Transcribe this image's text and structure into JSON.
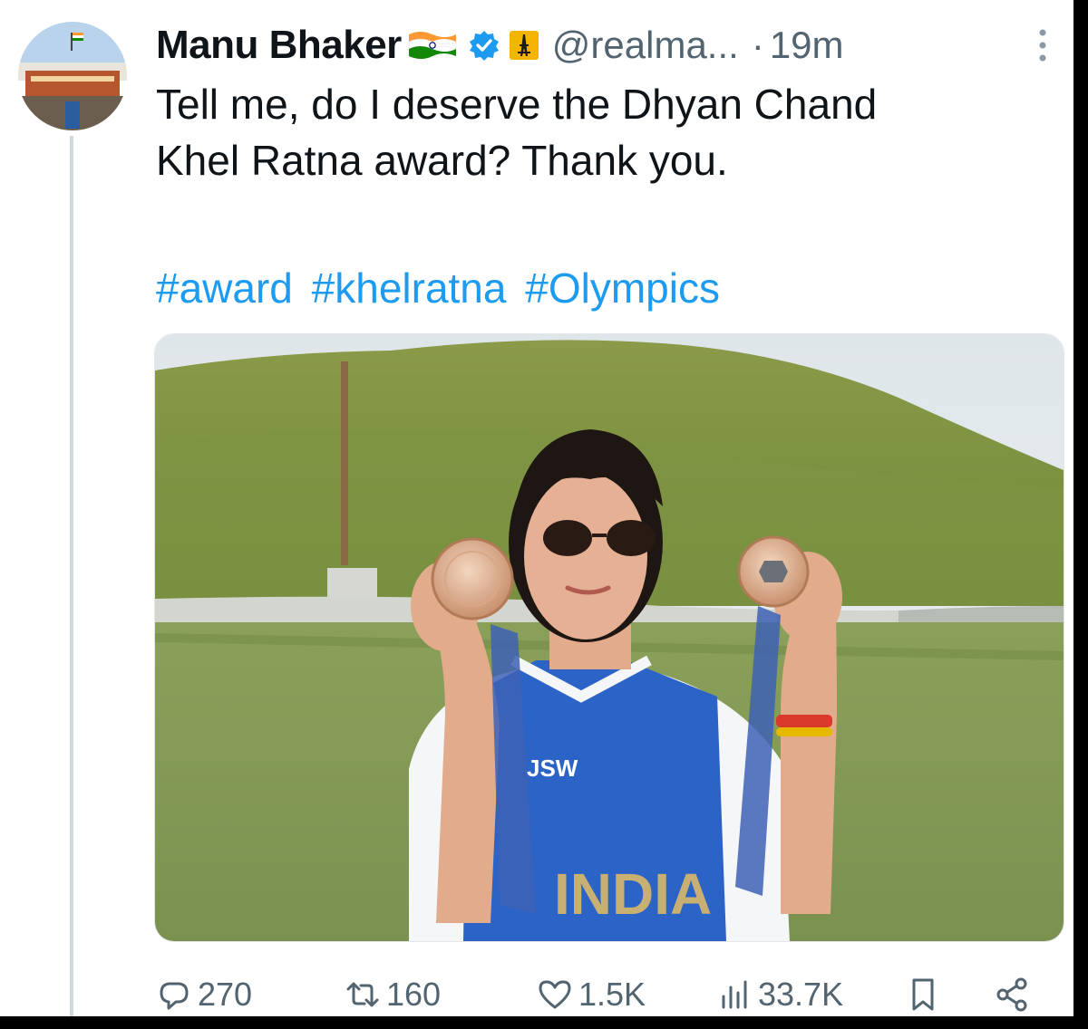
{
  "tweet": {
    "author_name": "Manu Bhaker",
    "handle": "@realma...",
    "separator": "·",
    "time": "19m",
    "text_line1": "Tell me, do I deserve the Dhyan Chand",
    "text_line2": "Khel Ratna award?  Thank you.",
    "hashtags": [
      "#award",
      "#khelratna",
      "#Olympics"
    ]
  },
  "icons": {
    "flag": "india-flag-icon",
    "verified": "verified-badge-icon",
    "affiliation": "eiffel-tower-icon",
    "more": "more-options-icon"
  },
  "metrics": {
    "replies": "270",
    "reposts": "160",
    "likes": "1.5K",
    "views": "33.7K"
  },
  "colors": {
    "hashtag": "#1d9bf0",
    "secondary_text": "#536471",
    "verified": "#1d9bf0",
    "thread_line": "#cfd9de"
  }
}
